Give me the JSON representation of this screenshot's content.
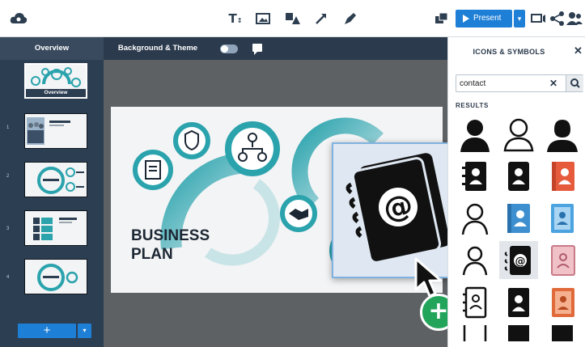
{
  "toolbar": {
    "tools": [
      "text-tool",
      "image-tool",
      "shapes-tool",
      "arrow-tool",
      "pen-tool"
    ],
    "present_label": "Present"
  },
  "tabs": {
    "overview": "Overview",
    "background_theme": "Background & Theme"
  },
  "slides": [
    {
      "number": "",
      "thumb_label": "Overview",
      "active": true
    },
    {
      "number": "1",
      "active": false
    },
    {
      "number": "2",
      "active": false
    },
    {
      "number": "3",
      "active": false
    },
    {
      "number": "4",
      "active": false
    }
  ],
  "add_slide_label": "+",
  "slide": {
    "title_line1": "BUSINESS",
    "title_line2": "PLAN"
  },
  "icons_panel": {
    "title": "ICONS & SYMBOLS",
    "search_value": "contact",
    "results_label": "RESULTS"
  },
  "colors": {
    "brand_blue": "#1e7fd6",
    "teal_ring": "#2aa3ad",
    "add_green": "#22a45a",
    "panel_dark": "#2c3e52"
  }
}
